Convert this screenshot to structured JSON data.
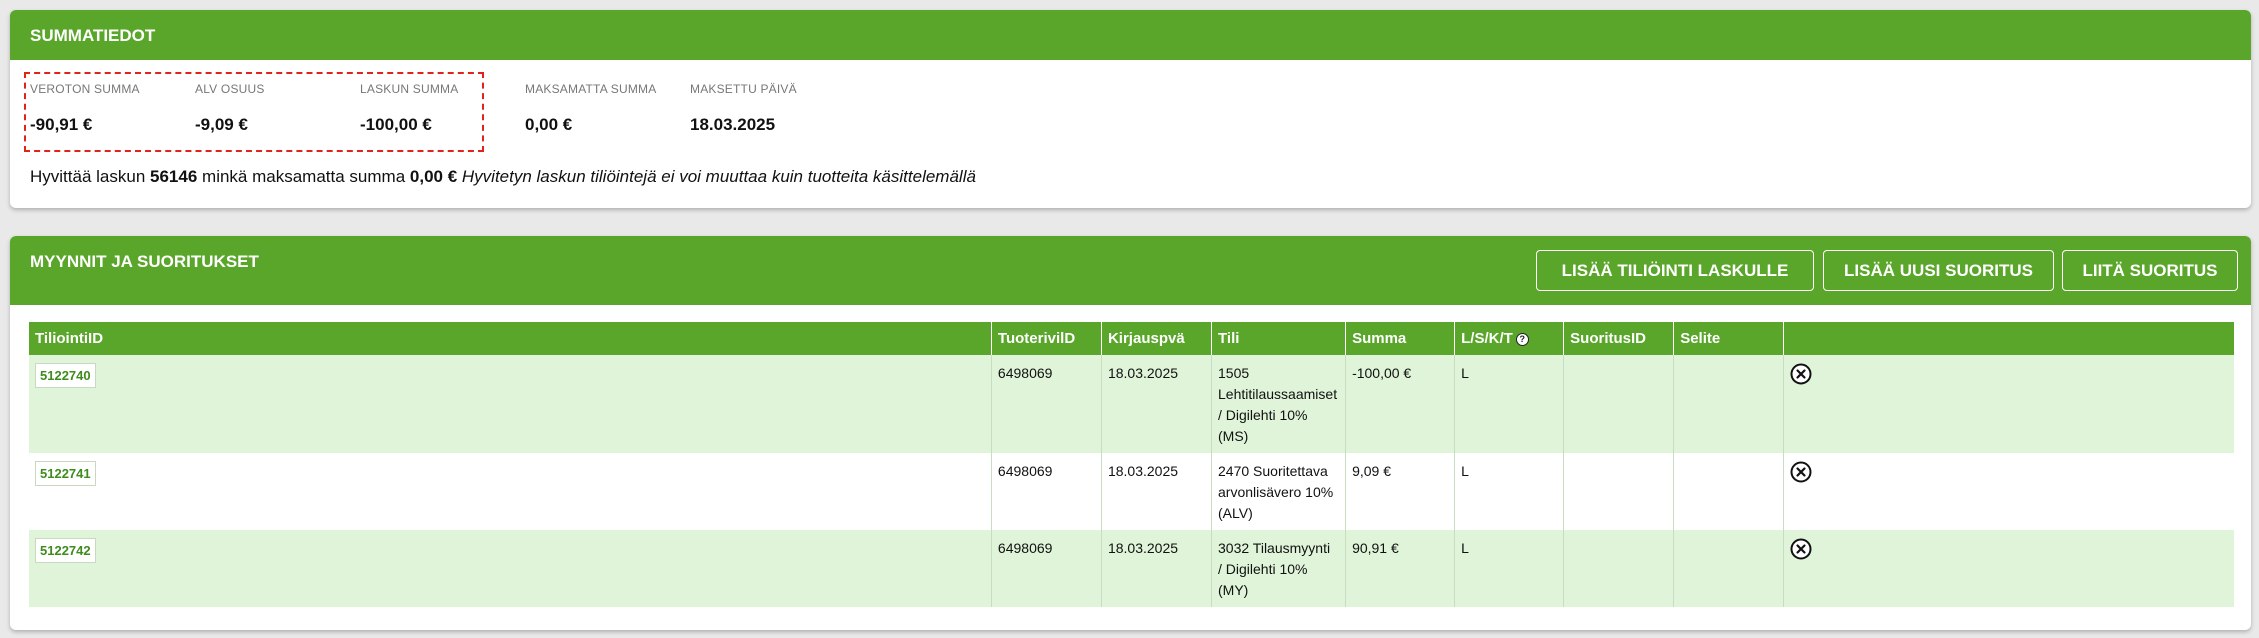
{
  "summary": {
    "title": "SUMMATIEDOT",
    "items": [
      {
        "label": "VEROTON SUMMA",
        "value": "-90,91 €"
      },
      {
        "label": "ALV OSUUS",
        "value": "-9,09 €"
      },
      {
        "label": "LASKUN SUMMA",
        "value": "-100,00 €"
      },
      {
        "label": "MAKSAMATTA SUMMA",
        "value": "0,00 €"
      },
      {
        "label": "MAKSETTU PÄIVÄ",
        "value": "18.03.2025"
      }
    ],
    "credit": {
      "prefix": "Hyvittää laskun",
      "invoice": "56146",
      "middle": "minkä maksamatta summa",
      "amount": "0,00 €",
      "note": "Hyvitetyn laskun tiliöintejä ei voi muuttaa kuin tuotteita käsittelemällä"
    }
  },
  "sales": {
    "title": "MYYNNIT JA SUORITUKSET",
    "buttons": {
      "add_posting": "LISÄÄ TILIÖINTI LASKULLE",
      "add_payment": "LISÄÄ UUSI SUORITUS",
      "attach_payment": "LIITÄ SUORITUS"
    },
    "columns": {
      "posting_id": "TiliointiID",
      "product_row_id": "TuoterivilD",
      "date": "Kirjauspvä",
      "account": "Tili",
      "amount": "Summa",
      "lskt": "L/S/K/T",
      "help_icon": "question-mark",
      "payment_id": "SuoritusID",
      "note": "Selite"
    },
    "rows": [
      {
        "posting_id": "5122740",
        "product_row_id": "6498069",
        "date": "18.03.2025",
        "account_lines": [
          "1505",
          "Lehtitilaussaamiset",
          "/ Digilehti 10%",
          "(MS)"
        ],
        "amount": "-100,00 €",
        "lskt": "L",
        "payment_id": "",
        "note": ""
      },
      {
        "posting_id": "5122741",
        "product_row_id": "6498069",
        "date": "18.03.2025",
        "account_lines": [
          "2470 Suoritettava",
          "arvonlisävero 10%",
          "(ALV)"
        ],
        "amount": "9,09 €",
        "lskt": "L",
        "payment_id": "",
        "note": ""
      },
      {
        "posting_id": "5122742",
        "product_row_id": "6498069",
        "date": "18.03.2025",
        "account_lines": [
          "3032 Tilausmyynti",
          "/ Digilehti 10%",
          "(MY)"
        ],
        "amount": "90,91 €",
        "lskt": "L",
        "payment_id": "",
        "note": ""
      }
    ]
  },
  "colors": {
    "header_green": "#5aa62a",
    "row_highlight": "#dff4d9",
    "selection_border": "#e0241b"
  }
}
